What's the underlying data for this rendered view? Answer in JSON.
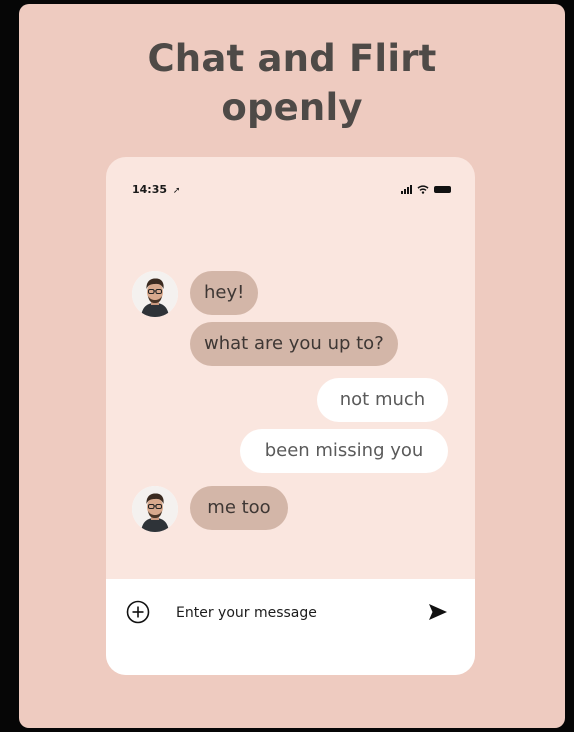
{
  "headline": {
    "line1": "Chat and Flirt",
    "line2": "openly"
  },
  "status_bar": {
    "time": "14:35",
    "location_icon": "location-arrow-icon",
    "signal_icon": "cellular-signal-icon",
    "wifi_icon": "wifi-icon",
    "battery_icon": "battery-icon"
  },
  "messages": [
    {
      "from": "them",
      "text": "hey!",
      "show_avatar": true
    },
    {
      "from": "them",
      "text": "what are you up to?",
      "show_avatar": false
    },
    {
      "from": "me",
      "text": "not much"
    },
    {
      "from": "me",
      "text": "been missing you"
    },
    {
      "from": "them",
      "text": "me too",
      "show_avatar": true
    }
  ],
  "composer": {
    "placeholder": "Enter your message",
    "add_icon": "plus-circle-icon",
    "send_icon": "send-icon"
  },
  "colors": {
    "card_background": "#eecbc0",
    "chat_background": "#fae6df",
    "incoming_bubble": "#d3b6a8",
    "outgoing_bubble": "#ffffff",
    "headline_text": "#4e4a47"
  }
}
